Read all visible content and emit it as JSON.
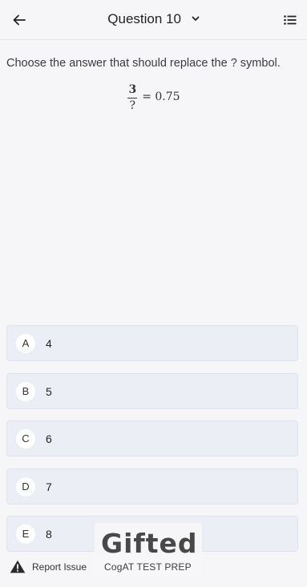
{
  "header": {
    "title": "Question 10"
  },
  "question": {
    "prompt": "Choose the answer that should replace the ? symbol.",
    "numerator": "3",
    "denominator": "?",
    "rhs": "= 0.75"
  },
  "options": [
    {
      "letter": "A",
      "value": "4"
    },
    {
      "letter": "B",
      "value": "5"
    },
    {
      "letter": "C",
      "value": "6"
    },
    {
      "letter": "D",
      "value": "7"
    },
    {
      "letter": "E",
      "value": "8"
    }
  ],
  "footer": {
    "report_label": "Report Issue"
  },
  "watermark": {
    "logo": "Gifted",
    "tagline": "CogAT TEST PREP"
  },
  "icons": {
    "back": "arrow-left-icon",
    "dropdown": "chevron-down-icon",
    "list": "list-icon",
    "warning": "warning-icon"
  },
  "colors": {
    "background": "#f6f6f9",
    "option_bg": "#eceef6"
  }
}
